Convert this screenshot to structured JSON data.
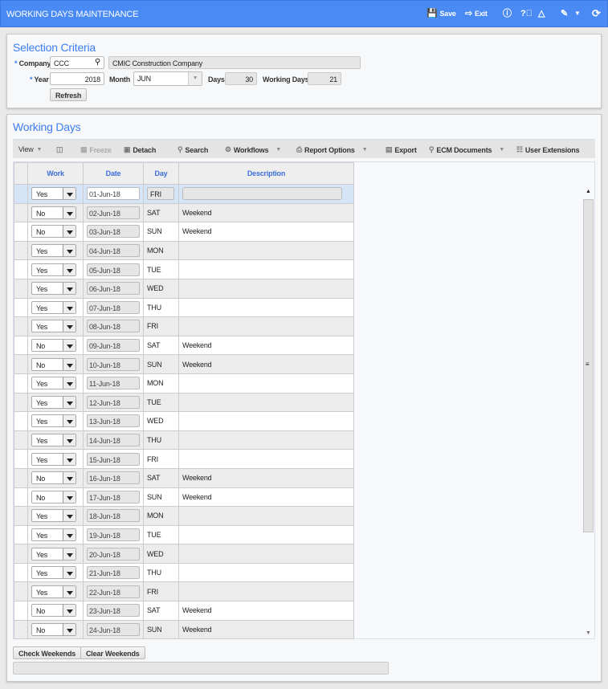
{
  "header": {
    "title": "WORKING DAYS MAINTENANCE",
    "save": "Save",
    "exit": "Exit",
    "icons": [
      "save-icon",
      "exit-icon",
      "info-icon",
      "help-icon",
      "warning-icon",
      "edit-icon",
      "refresh-icon"
    ]
  },
  "criteria": {
    "title": "Selection Criteria",
    "company_label": "Company",
    "company": "CCC",
    "company_name": "CMIC Construction Company",
    "year_label": "Year",
    "year": "2018",
    "month_label": "Month",
    "month": "JUN",
    "days_label": "Days",
    "days": "30",
    "working_days_label": "Working Days",
    "working_days": "21",
    "refresh": "Refresh",
    "required_mark": "*"
  },
  "working": {
    "title": "Working Days",
    "toolbar": {
      "view": "View",
      "freeze": "Freeze",
      "detach": "Detach",
      "search": "Search",
      "workflows": "Workflows",
      "report": "Report Options",
      "export": "Export",
      "ecm": "ECM Documents",
      "user_ext": "User Extensions"
    },
    "columns": [
      "Work",
      "Date",
      "Day",
      "Description"
    ],
    "rows": [
      [
        "Yes",
        "01-Jun-18",
        "FRI",
        ""
      ],
      [
        "No",
        "02-Jun-18",
        "SAT",
        "Weekend"
      ],
      [
        "No",
        "03-Jun-18",
        "SUN",
        "Weekend"
      ],
      [
        "Yes",
        "04-Jun-18",
        "MON",
        ""
      ],
      [
        "Yes",
        "05-Jun-18",
        "TUE",
        ""
      ],
      [
        "Yes",
        "06-Jun-18",
        "WED",
        ""
      ],
      [
        "Yes",
        "07-Jun-18",
        "THU",
        ""
      ],
      [
        "Yes",
        "08-Jun-18",
        "FRI",
        ""
      ],
      [
        "No",
        "09-Jun-18",
        "SAT",
        "Weekend"
      ],
      [
        "No",
        "10-Jun-18",
        "SUN",
        "Weekend"
      ],
      [
        "Yes",
        "11-Jun-18",
        "MON",
        ""
      ],
      [
        "Yes",
        "12-Jun-18",
        "TUE",
        ""
      ],
      [
        "Yes",
        "13-Jun-18",
        "WED",
        ""
      ],
      [
        "Yes",
        "14-Jun-18",
        "THU",
        ""
      ],
      [
        "Yes",
        "15-Jun-18",
        "FRI",
        ""
      ],
      [
        "No",
        "16-Jun-18",
        "SAT",
        "Weekend"
      ],
      [
        "No",
        "17-Jun-18",
        "SUN",
        "Weekend"
      ],
      [
        "Yes",
        "18-Jun-18",
        "MON",
        ""
      ],
      [
        "Yes",
        "19-Jun-18",
        "TUE",
        ""
      ],
      [
        "Yes",
        "20-Jun-18",
        "WED",
        ""
      ],
      [
        "Yes",
        "21-Jun-18",
        "THU",
        ""
      ],
      [
        "Yes",
        "22-Jun-18",
        "FRI",
        ""
      ],
      [
        "No",
        "23-Jun-18",
        "SAT",
        "Weekend"
      ],
      [
        "No",
        "24-Jun-18",
        "SUN",
        "Weekend"
      ]
    ],
    "check_weekends": "Check Weekends",
    "clear_weekends": "Clear Weekends"
  },
  "colors": {
    "accent": "#4a8af4",
    "title": "#3d7ef0",
    "selected_row": "#d6e4f7"
  }
}
